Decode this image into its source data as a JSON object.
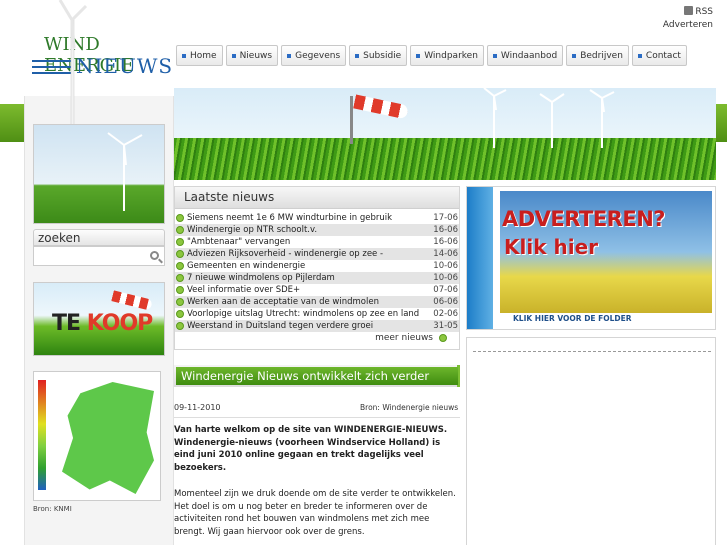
{
  "toplinks": {
    "rss": "RSS",
    "advertise": "Adverteren"
  },
  "logo": {
    "wind": "WIND ENERGIE",
    "nieuws": "NIEUWS"
  },
  "nav": [
    "Home",
    "Nieuws",
    "Gegevens",
    "Subsidie",
    "Windparken",
    "Windaanbod",
    "Bedrijven",
    "Contact"
  ],
  "search": {
    "title": "zoeken",
    "placeholder": ""
  },
  "tekoop": {
    "te": "TE ",
    "koop": "KOOP"
  },
  "map": {
    "credit": "Bron: KNMI"
  },
  "news": {
    "heading": "Laatste nieuws",
    "items": [
      {
        "title": "Siemens neemt 1e 6 MW windturbine in gebruik",
        "date": "17-06"
      },
      {
        "title": "Windenergie op NTR schoolt.v.",
        "date": "16-06"
      },
      {
        "title": "\"Ambtenaar\" vervangen",
        "date": "16-06"
      },
      {
        "title": "Adviezen Rijksoverheid - windenergie op zee -",
        "date": "14-06"
      },
      {
        "title": "Gemeenten en windenergie",
        "date": "10-06"
      },
      {
        "title": "7 nieuwe windmolens op Pijlerdam",
        "date": "10-06"
      },
      {
        "title": "Veel informatie over SDE+",
        "date": "07-06"
      },
      {
        "title": "Werken aan de acceptatie van de windmolen",
        "date": "06-06"
      },
      {
        "title": "Voorlopige uitslag Utrecht: windmolens op zee en land",
        "date": "02-06"
      },
      {
        "title": "Weerstand in Duitsland tegen verdere groei",
        "date": "31-05"
      }
    ],
    "more": "meer nieuws"
  },
  "ad": {
    "line1": "ADVERTEREN?",
    "line2": "Klik hier",
    "caption": "KLIK HIER VOOR DE FOLDER"
  },
  "article": {
    "title": "Windenergie Nieuws ontwikkelt zich verder",
    "date": "09-11-2010",
    "source": "Bron: Windenergie nieuws",
    "lead": "Van harte welkom op de site van WINDENERGIE-NIEUWS. Windenergie-nieuws (voorheen Windservice Holland) is eind juni 2010 online gegaan en trekt dagelijks veel bezoekers.",
    "body": "Momenteel zijn we druk doende om de site verder te ontwikkelen. Het doel is om u nog beter en breder te informeren over de activiteiten rond het bouwen van windmolens met zich mee brengt. Wij gaan hiervoor ook over de grens."
  }
}
